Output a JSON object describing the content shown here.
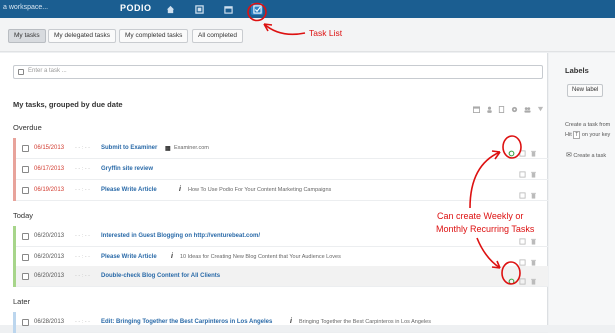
{
  "topbar": {
    "workspace": "a workspace...",
    "brand": "PODIO",
    "nav_icons": [
      "home-icon",
      "app-icon",
      "calendar-icon",
      "tasks-icon"
    ]
  },
  "tabs": [
    {
      "label": "My tasks",
      "active": true
    },
    {
      "label": "My delegated tasks",
      "active": false
    },
    {
      "label": "My completed tasks",
      "active": false
    },
    {
      "label": "All completed",
      "active": false
    }
  ],
  "new_task": {
    "placeholder": "Enter a task ..."
  },
  "list": {
    "heading": "My tasks, grouped by due date",
    "sections": [
      {
        "name": "Overdue",
        "rows": [
          {
            "date": "06/15/2013",
            "dash": "- - : - -",
            "title": "Submit to Examiner",
            "ref_icon": "app-ref-icon",
            "ref": "Examiner.com",
            "recurring": true,
            "highlight": false
          },
          {
            "date": "06/17/2013",
            "dash": "- - : - -",
            "title": "Gryffin site review",
            "ref_icon": "",
            "ref": "",
            "recurring": false,
            "highlight": false
          },
          {
            "date": "06/19/2013",
            "dash": "- - : - -",
            "title": "Please Write Article",
            "ref_icon": "i",
            "ref": "How To Use Podio For Your Content Marketing Campaigns",
            "recurring": false,
            "highlight": false
          }
        ]
      },
      {
        "name": "Today",
        "rows": [
          {
            "date": "06/20/2013",
            "dash": "- - : - -",
            "title": "Interested in Guest Blogging on http://venturebeat.com/",
            "ref_icon": "",
            "ref": "",
            "recurring": false,
            "highlight": false
          },
          {
            "date": "06/20/2013",
            "dash": "- - : - -",
            "title": "Please Write Article",
            "ref_icon": "i",
            "ref": "10 Ideas for Creating New Blog Content that Your Audience Loves",
            "recurring": false,
            "highlight": false
          },
          {
            "date": "06/20/2013",
            "dash": "- - : - -",
            "title": "Double-check Blog Content for All Clients",
            "ref_icon": "",
            "ref": "",
            "recurring": true,
            "highlight": true
          }
        ]
      },
      {
        "name": "Later",
        "rows": [
          {
            "date": "06/28/2013",
            "dash": "- - : - -",
            "title": "Edit: Bringing Together the Best Carpinteros in Los Angeles",
            "ref_icon": "i",
            "ref": "Bringing Together the Best Carpinteros in Los Angeles",
            "recurring": false,
            "highlight": false
          }
        ]
      }
    ]
  },
  "sidebar": {
    "title": "Labels",
    "new_label": "New label",
    "hint_line1": "Create a task from",
    "hint_line2_pre": "Hit",
    "hint_key": "T",
    "hint_line2_post": "on your key",
    "email_hint": "Create a task"
  },
  "annotations": {
    "task_list": "Task List",
    "recurring_line1": "Can create Weekly or",
    "recurring_line2": "Monthly Recurring Tasks"
  },
  "colors": {
    "topbar": "#1b5e91",
    "overdue_bar": "#e8a39b",
    "today_bar": "#a7d58a",
    "later_bar": "#bcd6ee",
    "link": "#2a6aa8",
    "overdue_date": "#d23b2f",
    "annotation": "#dd1111"
  }
}
